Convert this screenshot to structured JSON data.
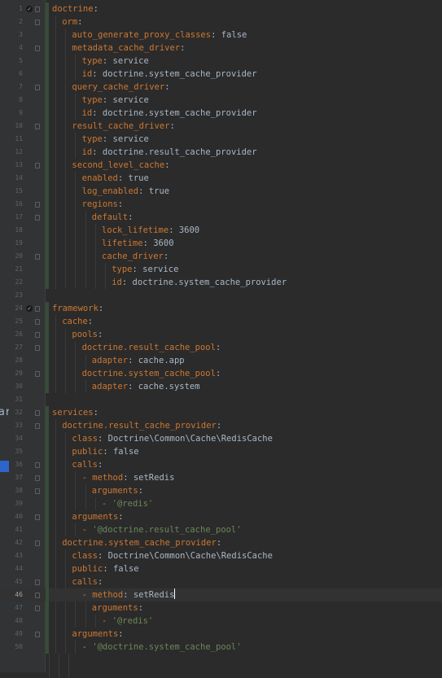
{
  "editor": {
    "current_line": 46,
    "left_panel_fragments": [
      "ar"
    ],
    "lines": [
      {
        "n": 1,
        "indent": 0,
        "key": "doctrine",
        "value": "",
        "vtype": "",
        "bookmark": true
      },
      {
        "n": 2,
        "indent": 1,
        "key": "orm",
        "value": "",
        "vtype": ""
      },
      {
        "n": 3,
        "indent": 2,
        "key": "auto_generate_proxy_classes",
        "value": "false",
        "vtype": "plain"
      },
      {
        "n": 4,
        "indent": 2,
        "key": "metadata_cache_driver",
        "value": "",
        "vtype": ""
      },
      {
        "n": 5,
        "indent": 3,
        "key": "type",
        "value": "service",
        "vtype": "plain"
      },
      {
        "n": 6,
        "indent": 3,
        "key": "id",
        "value": "doctrine.system_cache_provider",
        "vtype": "plain"
      },
      {
        "n": 7,
        "indent": 2,
        "key": "query_cache_driver",
        "value": "",
        "vtype": ""
      },
      {
        "n": 8,
        "indent": 3,
        "key": "type",
        "value": "service",
        "vtype": "plain"
      },
      {
        "n": 9,
        "indent": 3,
        "key": "id",
        "value": "doctrine.system_cache_provider",
        "vtype": "plain"
      },
      {
        "n": 10,
        "indent": 2,
        "key": "result_cache_driver",
        "value": "",
        "vtype": ""
      },
      {
        "n": 11,
        "indent": 3,
        "key": "type",
        "value": "service",
        "vtype": "plain"
      },
      {
        "n": 12,
        "indent": 3,
        "key": "id",
        "value": "doctrine.result_cache_provider",
        "vtype": "plain"
      },
      {
        "n": 13,
        "indent": 2,
        "key": "second_level_cache",
        "value": "",
        "vtype": ""
      },
      {
        "n": 14,
        "indent": 3,
        "key": "enabled",
        "value": "true",
        "vtype": "plain"
      },
      {
        "n": 15,
        "indent": 3,
        "key": "log_enabled",
        "value": "true",
        "vtype": "plain"
      },
      {
        "n": 16,
        "indent": 3,
        "key": "regions",
        "value": "",
        "vtype": ""
      },
      {
        "n": 17,
        "indent": 4,
        "key": "default",
        "value": "",
        "vtype": ""
      },
      {
        "n": 18,
        "indent": 5,
        "key": "lock_lifetime",
        "value": "3600",
        "vtype": "plain"
      },
      {
        "n": 19,
        "indent": 5,
        "key": "lifetime",
        "value": "3600",
        "vtype": "plain"
      },
      {
        "n": 20,
        "indent": 5,
        "key": "cache_driver",
        "value": "",
        "vtype": ""
      },
      {
        "n": 21,
        "indent": 6,
        "key": "type",
        "value": "service",
        "vtype": "plain"
      },
      {
        "n": 22,
        "indent": 6,
        "key": "id",
        "value": "doctrine.system_cache_provider",
        "vtype": "plain"
      },
      {
        "n": 23,
        "indent": 0,
        "key": "",
        "value": "",
        "vtype": ""
      },
      {
        "n": 24,
        "indent": 0,
        "key": "framework",
        "value": "",
        "vtype": "",
        "bookmark": true
      },
      {
        "n": 25,
        "indent": 1,
        "key": "cache",
        "value": "",
        "vtype": ""
      },
      {
        "n": 26,
        "indent": 2,
        "key": "pools",
        "value": "",
        "vtype": ""
      },
      {
        "n": 27,
        "indent": 3,
        "key": "doctrine.result_cache_pool",
        "value": "",
        "vtype": ""
      },
      {
        "n": 28,
        "indent": 4,
        "key": "adapter",
        "value": "cache.app",
        "vtype": "plain"
      },
      {
        "n": 29,
        "indent": 3,
        "key": "doctrine.system_cache_pool",
        "value": "",
        "vtype": ""
      },
      {
        "n": 30,
        "indent": 4,
        "key": "adapter",
        "value": "cache.system",
        "vtype": "plain"
      },
      {
        "n": 31,
        "indent": 0,
        "key": "",
        "value": "",
        "vtype": ""
      },
      {
        "n": 32,
        "indent": 0,
        "key": "services",
        "value": "",
        "vtype": ""
      },
      {
        "n": 33,
        "indent": 1,
        "key": "doctrine.result_cache_provider",
        "value": "",
        "vtype": ""
      },
      {
        "n": 34,
        "indent": 2,
        "key": "class",
        "value": "Doctrine\\Common\\Cache\\RedisCache",
        "vtype": "plain"
      },
      {
        "n": 35,
        "indent": 2,
        "key": "public",
        "value": "false",
        "vtype": "plain"
      },
      {
        "n": 36,
        "indent": 2,
        "key": "calls",
        "value": "",
        "vtype": ""
      },
      {
        "n": 37,
        "indent": 3,
        "dash": true,
        "key": "method",
        "value": "setRedis",
        "vtype": "plain"
      },
      {
        "n": 38,
        "indent": 4,
        "key": "arguments",
        "value": "",
        "vtype": ""
      },
      {
        "n": 39,
        "indent": 5,
        "dash": true,
        "key": "",
        "value": "'@redis'",
        "vtype": "str"
      },
      {
        "n": 40,
        "indent": 2,
        "key": "arguments",
        "value": "",
        "vtype": ""
      },
      {
        "n": 41,
        "indent": 3,
        "dash": true,
        "key": "",
        "value": "'@doctrine.result_cache_pool'",
        "vtype": "str"
      },
      {
        "n": 42,
        "indent": 1,
        "key": "doctrine.system_cache_provider",
        "value": "",
        "vtype": ""
      },
      {
        "n": 43,
        "indent": 2,
        "key": "class",
        "value": "Doctrine\\Common\\Cache\\RedisCache",
        "vtype": "plain"
      },
      {
        "n": 44,
        "indent": 2,
        "key": "public",
        "value": "false",
        "vtype": "plain"
      },
      {
        "n": 45,
        "indent": 2,
        "key": "calls",
        "value": "",
        "vtype": ""
      },
      {
        "n": 46,
        "indent": 3,
        "dash": true,
        "key": "method",
        "value": "setRedis",
        "vtype": "plain",
        "caret": true
      },
      {
        "n": 47,
        "indent": 4,
        "key": "arguments",
        "value": "",
        "vtype": ""
      },
      {
        "n": 48,
        "indent": 5,
        "dash": true,
        "key": "",
        "value": "'@redis'",
        "vtype": "str"
      },
      {
        "n": 49,
        "indent": 2,
        "key": "arguments",
        "value": "",
        "vtype": ""
      },
      {
        "n": 50,
        "indent": 3,
        "dash": true,
        "key": "",
        "value": "'@doctrine.system_cache_pool'",
        "vtype": "str"
      }
    ]
  },
  "colors": {
    "background": "#2b2b2b",
    "gutter": "#313335",
    "key": "#cc7832",
    "value": "#a9b7c6",
    "string": "#6a8759",
    "line_number": "#606366",
    "vcs_added": "#384c38"
  }
}
